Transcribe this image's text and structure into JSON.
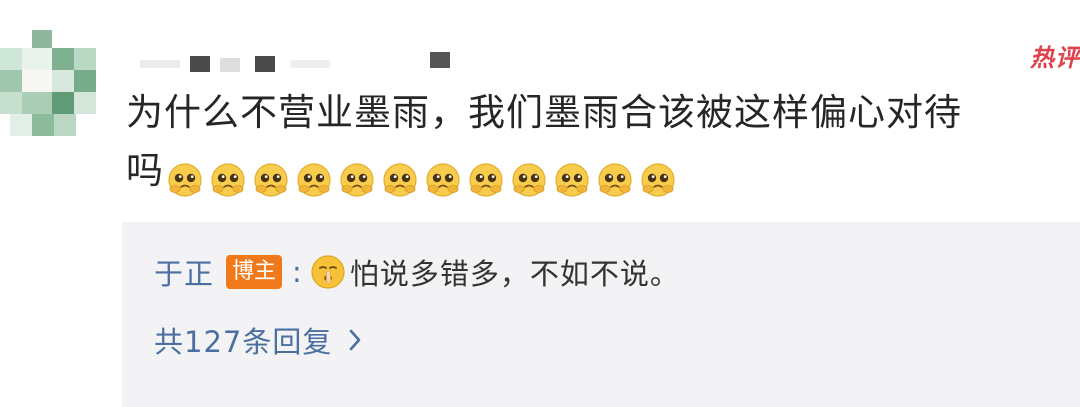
{
  "comment": {
    "hot_label": "热评",
    "text_line": "为什么不营业墨雨，我们墨雨合该被这样偏心对待",
    "text_tail": "吗",
    "emoji_icon": "pleading-face-icon",
    "emoji_count": 12
  },
  "reply": {
    "author": "于正",
    "badge": "博主",
    "colon": ":",
    "icon": "shush-face-icon",
    "text": "怕说多错多，不如不说。",
    "more_label": "共127条回复",
    "more_icon": "chevron-right-icon"
  },
  "colors": {
    "hot": "#e0424c",
    "link": "#4a6fa0",
    "badge_bg": "#f07a1b",
    "panel_bg": "#f3f3f5"
  }
}
